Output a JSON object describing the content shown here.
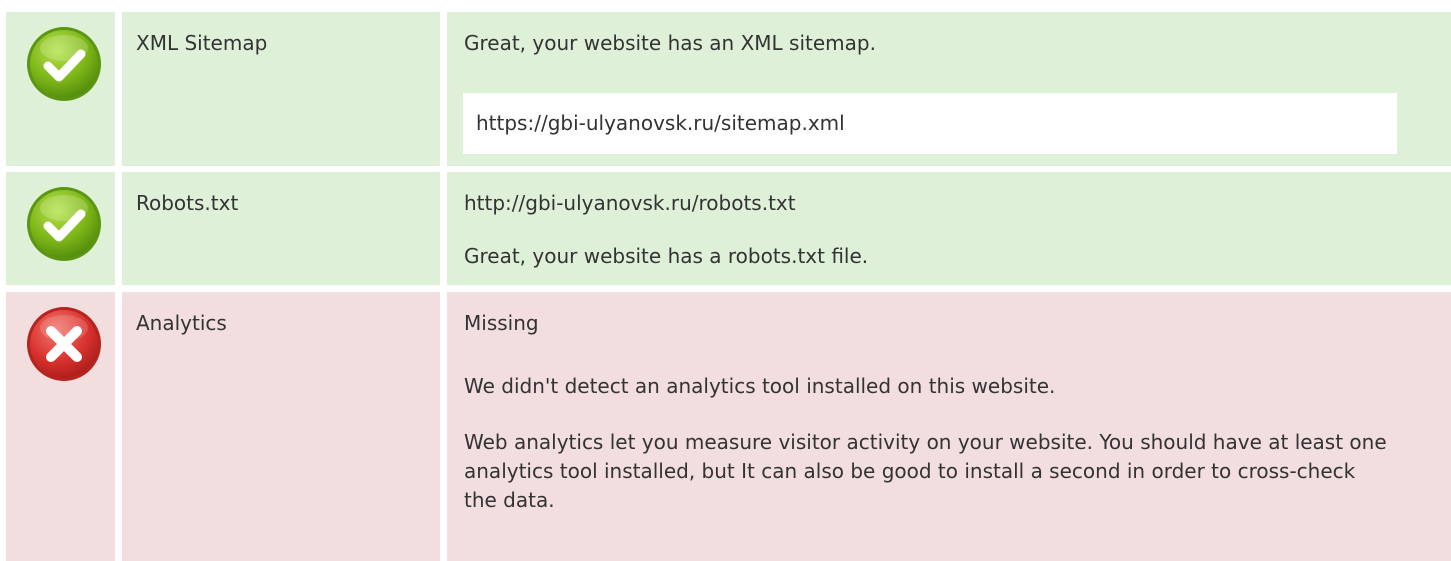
{
  "colors": {
    "pass_background": "#dff0d8",
    "fail_background": "#f2dede",
    "pass_icon": "#7cb518",
    "fail_icon": "#d9322e"
  },
  "checks": [
    {
      "status": "pass",
      "status_icon": "check-circle-icon",
      "label": "XML Sitemap",
      "message": "Great, your website has an XML sitemap.",
      "url": "https://gbi-ulyanovsk.ru/sitemap.xml"
    },
    {
      "status": "pass",
      "status_icon": "check-circle-icon",
      "label": "Robots.txt",
      "url": "http://gbi-ulyanovsk.ru/robots.txt",
      "message": "Great, your website has a robots.txt file."
    },
    {
      "status": "fail",
      "status_icon": "cross-circle-icon",
      "label": "Analytics",
      "value": "Missing",
      "message": "We didn't detect an analytics tool installed on this website.",
      "advice": "Web analytics let you measure visitor activity on your website. You should have at least one analytics tool installed, but It can also be good to install a second in order to cross-check the data."
    }
  ]
}
